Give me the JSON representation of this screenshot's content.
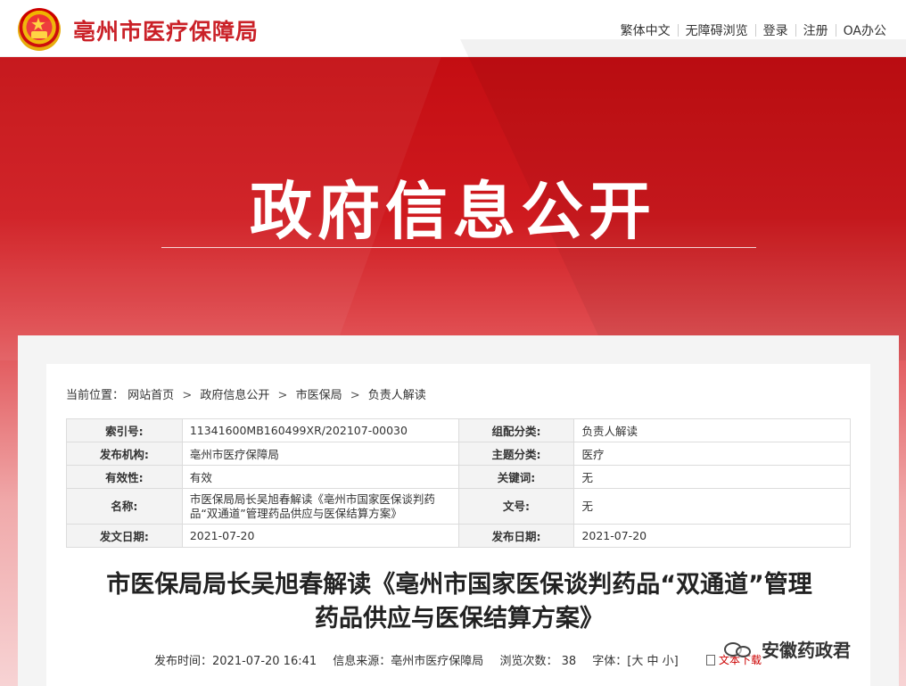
{
  "header": {
    "site_name": "亳州市医疗保障局",
    "links": [
      "繁体中文",
      "无障碍浏览",
      "登录",
      "注册",
      "OA办公"
    ]
  },
  "banner": {
    "title": "政府信息公开"
  },
  "breadcrumb": {
    "prefix": "当前位置：",
    "items": [
      "网站首页",
      "政府信息公开",
      "市医保局",
      "负责人解读"
    ],
    "separator": ">"
  },
  "meta": {
    "rows": [
      {
        "k1": "索引号:",
        "v1": "11341600MB160499XR/202107-00030",
        "k2": "组配分类:",
        "v2": "负责人解读"
      },
      {
        "k1": "发布机构:",
        "v1": "亳州市医疗保障局",
        "k2": "主题分类:",
        "v2": "医疗"
      },
      {
        "k1": "有效性:",
        "v1": "有效",
        "k2": "关键词:",
        "v2": "无"
      },
      {
        "k1": "名称:",
        "v1": "市医保局局长吴旭春解读《亳州市国家医保谈判药品“双通道”管理药品供应与医保结算方案》",
        "k2": "文号:",
        "v2": "无"
      },
      {
        "k1": "发文日期:",
        "v1": "2021-07-20",
        "k2": "发布日期:",
        "v2": "2021-07-20"
      }
    ]
  },
  "article": {
    "title_line1": "市医保局局长吴旭春解读《亳州市国家医保谈判药品“双通道”管理",
    "title_line2": "药品供应与医保结算方案》",
    "publish_time": "发布时间：2021-07-20 16:41",
    "source": "信息来源：亳州市医疗保障局",
    "views": "浏览次数：  38",
    "font_size_label": "字体：",
    "font_size_options": "[大 中 小]",
    "download": "文本下载"
  },
  "watermark": {
    "text": "安徽药政君"
  }
}
